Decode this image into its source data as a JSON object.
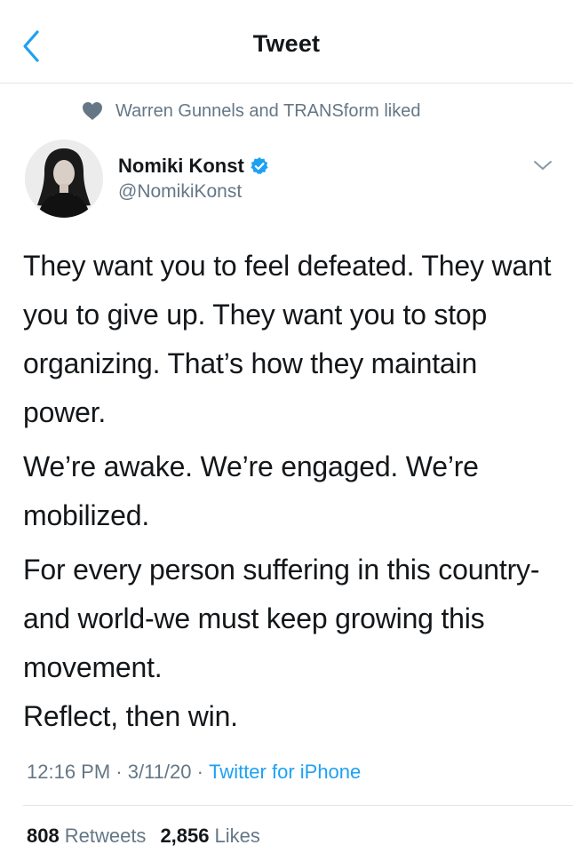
{
  "header": {
    "title": "Tweet"
  },
  "social_context": {
    "text": "Warren Gunnels and TRANSform liked"
  },
  "author": {
    "name": "Nomiki Konst",
    "handle": "@NomikiKonst"
  },
  "tweet": {
    "paragraphs": [
      "They want you to feel defeated. They want you to give up. They want you to stop organizing. That’s how they maintain power.",
      "We’re awake. We’re engaged. We’re mobilized.",
      "For every person suffering in this country-and world-we must keep growing this movement.",
      "Reflect, then win."
    ]
  },
  "meta": {
    "time": "12:16 PM",
    "date": "3/11/20",
    "source": "Twitter for iPhone",
    "separator": " · "
  },
  "stats": {
    "retweets_count": "808",
    "retweets_label": "Retweets",
    "likes_count": "2,856",
    "likes_label": "Likes"
  },
  "colors": {
    "accent": "#1da1f2",
    "secondary_text": "#657786",
    "primary_text": "#14171a",
    "divider": "#e1e8ed"
  },
  "icons": {
    "back": "chevron-left-icon",
    "heart": "heart-icon",
    "verified": "verified-badge-icon",
    "caret": "chevron-down-icon"
  }
}
